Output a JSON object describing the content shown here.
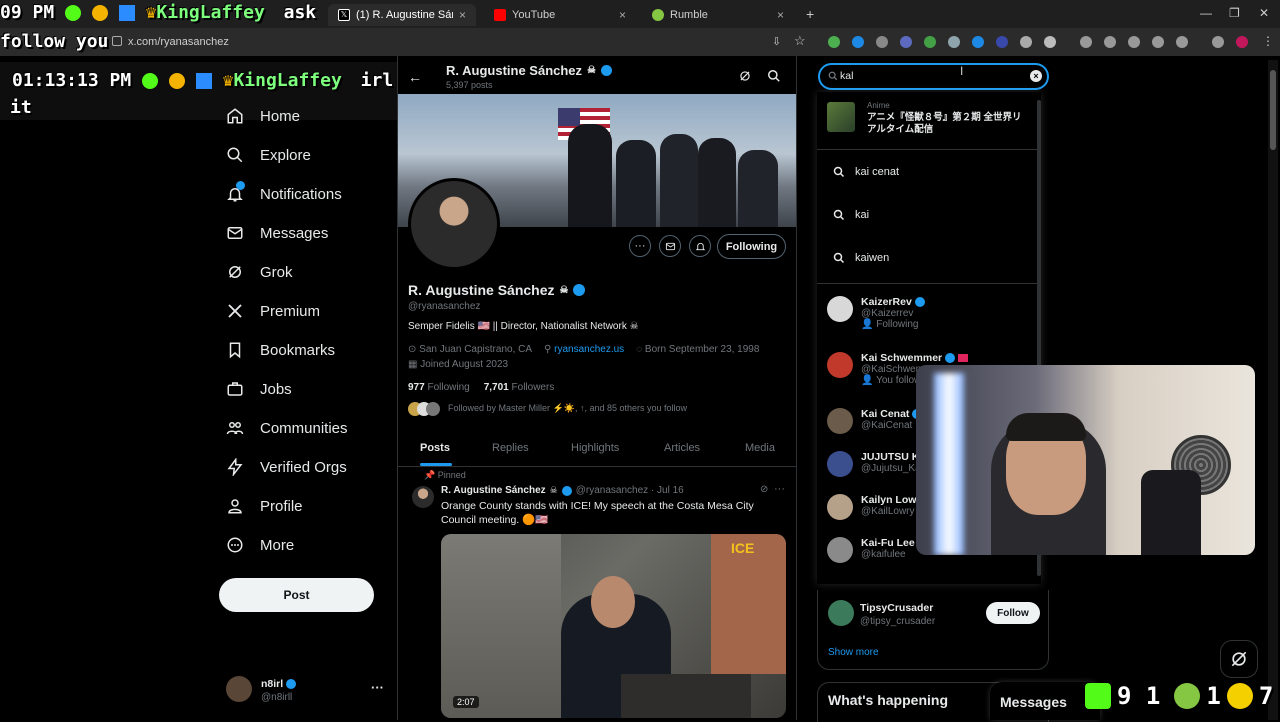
{
  "browser": {
    "tabs": [
      {
        "label": "(1) R. Augustine Sánchez",
        "active": true
      },
      {
        "label": "YouTube",
        "active": false
      },
      {
        "label": "Rumble",
        "active": false
      }
    ],
    "url": "x.com/ryanasanchez"
  },
  "overlay": {
    "line1_time": "09 PM",
    "line1_name": "KingLaffey",
    "line1_msg": "ask",
    "line2": "follow you",
    "line3_time": "01:13:13 PM",
    "line3_name": "KingLaffey",
    "line3_msg": "irl",
    "line4": "it"
  },
  "nav": {
    "items": [
      {
        "label": "Home",
        "icon": "home-icon"
      },
      {
        "label": "Explore",
        "icon": "search-icon"
      },
      {
        "label": "Notifications",
        "icon": "bell-icon"
      },
      {
        "label": "Messages",
        "icon": "mail-icon"
      },
      {
        "label": "Grok",
        "icon": "grok-icon"
      },
      {
        "label": "Premium",
        "icon": "x-logo-icon"
      },
      {
        "label": "Bookmarks",
        "icon": "bookmark-icon"
      },
      {
        "label": "Jobs",
        "icon": "briefcase-icon"
      },
      {
        "label": "Communities",
        "icon": "people-icon"
      },
      {
        "label": "Verified Orgs",
        "icon": "lightning-icon"
      },
      {
        "label": "Profile",
        "icon": "person-icon"
      },
      {
        "label": "More",
        "icon": "more-circle-icon"
      }
    ],
    "post_label": "Post",
    "account_name": "n8irl",
    "account_handle": "@n8irll"
  },
  "profile": {
    "header_name": "R. Augustine Sánchez",
    "posts_count": "5,397 posts",
    "name": "R. Augustine Sánchez",
    "handle": "@ryanasanchez",
    "bio": "Semper Fidelis 🇺🇸 || Director, Nationalist Network",
    "location": "San Juan Capistrano, CA",
    "website": "ryansanchez.us",
    "born": "Born September 23, 1998",
    "joined": "Joined August 2023",
    "following_count": "977",
    "following_label": "Following",
    "followers_count": "7,701",
    "followers_label": "Followers",
    "followed_by": "Followed by Master Miller ⚡☀️, ↑, and 85 others you follow",
    "following_button": "Following",
    "tabs": [
      "Posts",
      "Replies",
      "Highlights",
      "Articles",
      "Media"
    ],
    "pinned_label": "Pinned",
    "post_name": "R. Augustine Sánchez",
    "post_meta": "@ryanasanchez · Jul 16",
    "post_text": "Orange County stands with ICE! My speech at the Costa Mesa City Council meeting. 🟠🇺🇸",
    "video_duration": "2:07"
  },
  "search": {
    "query": "kal",
    "anime_category": "Anime",
    "anime_title": "アニメ『怪獣８号』第２期 全世界リアルタイム配信",
    "suggestions": [
      "kai cenat",
      "kai",
      "kaiwen"
    ],
    "users": [
      {
        "name": "KaizerRev",
        "handle": "@Kaizerrev",
        "sub": "Following",
        "color": "#d8d8d8"
      },
      {
        "name": "Kai Schwemmer",
        "handle": "@KaiSchwemmer",
        "sub": "You follow",
        "color": "#c0392b"
      },
      {
        "name": "Kai Cenat",
        "handle": "@KaiCenat",
        "sub": "",
        "color": "#6b5b4b"
      },
      {
        "name": "JUJUTSU KAISEN",
        "handle": "@Jujutsu_Kaisen",
        "sub": "",
        "color": "#3b4f8f"
      },
      {
        "name": "Kailyn Lowry",
        "handle": "@KailLowry",
        "sub": "",
        "color": "#b5a08a"
      },
      {
        "name": "Kai-Fu Lee",
        "handle": "@kaifulee",
        "sub": "",
        "color": "#8a8a8a"
      }
    ]
  },
  "who_to_follow": {
    "name": "TipsyCrusader",
    "handle": "@tipsy_crusader",
    "follow_label": "Follow",
    "show_more": "Show more"
  },
  "whats_happening": "What's happening",
  "messages_drawer": "Messages",
  "stream_stats": {
    "kick_count": "9 1",
    "rumble_count": "1",
    "other_count": "7"
  }
}
